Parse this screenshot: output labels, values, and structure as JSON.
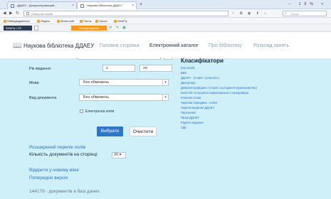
{
  "browser": {
    "tab1_title": "ДДАЕУ - Дніпропетровський ...",
    "tab2_title": "Наукова бібліотека ДДАЕУ",
    "new_tab": "+",
    "window_controls": "– 16% +",
    "url": "li.dsau.dp.ua/cat/",
    "search_placeholder": "Пошук",
    "bookmarks": [
      "Найвідвідуваніші",
      "Яндекс",
      "Мини-сайт",
      "Почта",
      "Числа",
      "WebFly"
    ],
    "addon1": "WebFly • F8",
    "addon3": "Налаштування"
  },
  "header": {
    "site_title": "Наукова бібліотека ДДАЕУ",
    "nav": [
      "Головна сторінка",
      "Електронний каталог",
      "Про бібліотеку",
      "Розклад занять"
    ],
    "active_nav_index": 1
  },
  "form": {
    "year_label": "Рік видання",
    "year_from": "з",
    "year_to": "по",
    "language_label": "Мова",
    "language_value": "Без обмежень",
    "doctype_label": "Вид документа",
    "doctype_value": "Без обмежень",
    "ecopy_label": "Електронна копія",
    "search_button": "Вибрати",
    "clear_button": "Очистити",
    "extended_fields_link": "Розширений перелік полів",
    "doc_count_label": "Кількість документів на сторінці",
    "doc_count_value": "20",
    "open_new_window_link": "Відкрити у новому вікні",
    "prev_version_link": "Попередня версія",
    "footer_text": "144179 - документів в базі даних."
  },
  "classifiers": {
    "title": "Класифікатори",
    "items": [
      "Key words",
      "ББК",
      "ДДАЕУ - історія і сучасність",
      "Дисертації",
      "Дніпропетровщина: історія і сьогодення (краєзнавство)",
      "Екологія та охорона навколишнього середовища",
      "Ключові слова",
      "Наукова періодика - online",
      "Наукові видання ДДАЕУ",
      "Персоналії",
      "Праці ДДАЕУ",
      "Рідкісні видання",
      "УДК"
    ]
  }
}
